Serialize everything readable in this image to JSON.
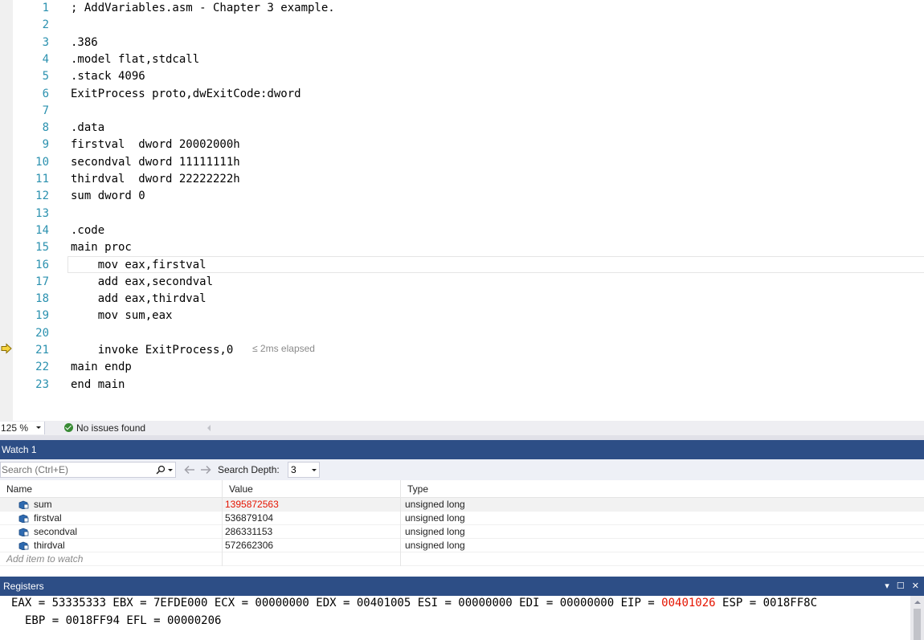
{
  "editor": {
    "lines": [
      {
        "num": "1",
        "code": "; AddVariables.asm - Chapter 3 example."
      },
      {
        "num": "2",
        "code": ""
      },
      {
        "num": "3",
        "code": ".386"
      },
      {
        "num": "4",
        "code": ".model flat,stdcall"
      },
      {
        "num": "5",
        "code": ".stack 4096"
      },
      {
        "num": "6",
        "code": "ExitProcess proto,dwExitCode:dword"
      },
      {
        "num": "7",
        "code": ""
      },
      {
        "num": "8",
        "code": ".data"
      },
      {
        "num": "9",
        "code": "firstval  dword 20002000h"
      },
      {
        "num": "10",
        "code": "secondval dword 11111111h"
      },
      {
        "num": "11",
        "code": "thirdval  dword 22222222h"
      },
      {
        "num": "12",
        "code": "sum dword 0"
      },
      {
        "num": "13",
        "code": ""
      },
      {
        "num": "14",
        "code": ".code"
      },
      {
        "num": "15",
        "code": "main proc"
      },
      {
        "num": "16",
        "code": "    mov eax,firstval"
      },
      {
        "num": "17",
        "code": "    add eax,secondval"
      },
      {
        "num": "18",
        "code": "    add eax,thirdval"
      },
      {
        "num": "19",
        "code": "    mov sum,eax"
      },
      {
        "num": "20",
        "code": ""
      },
      {
        "num": "21",
        "code": "    invoke ExitProcess,0"
      },
      {
        "num": "22",
        "code": "main endp"
      },
      {
        "num": "23",
        "code": "end main"
      }
    ],
    "perf_tip": "≤ 2ms elapsed"
  },
  "status": {
    "zoom": "125 %",
    "issues": "No issues found"
  },
  "watch": {
    "title": "Watch 1",
    "search_placeholder": "Search (Ctrl+E)",
    "search_depth_label": "Search Depth:",
    "search_depth_value": "3",
    "columns": {
      "name": "Name",
      "value": "Value",
      "type": "Type"
    },
    "rows": [
      {
        "name": "sum",
        "value": "1395872563",
        "type": "unsigned long"
      },
      {
        "name": "firstval",
        "value": "536879104",
        "type": "unsigned long"
      },
      {
        "name": "secondval",
        "value": "286331153",
        "type": "unsigned long"
      },
      {
        "name": "thirdval",
        "value": "572662306",
        "type": "unsigned long"
      }
    ],
    "add_item": "Add item to watch"
  },
  "registers": {
    "title": "Registers",
    "line1_before": "EAX = 53335333 EBX = 7EFDE000 ECX = 00000000 EDX = 00401005 ESI = 00000000 EDI = 00000000 EIP = ",
    "eip": "00401026",
    "line1_after": " ESP = 0018FF8C",
    "line2": "EBP = 0018FF94 EFL = 00000206"
  },
  "colors": {
    "line_number": "#2b91af",
    "tool_title_bg": "#2d4e86",
    "changed_value": "#e51400"
  },
  "icons": [
    "execution-arrow-icon",
    "check-circle-icon",
    "search-icon",
    "back-arrow-icon",
    "forward-arrow-icon",
    "variable-icon"
  ]
}
